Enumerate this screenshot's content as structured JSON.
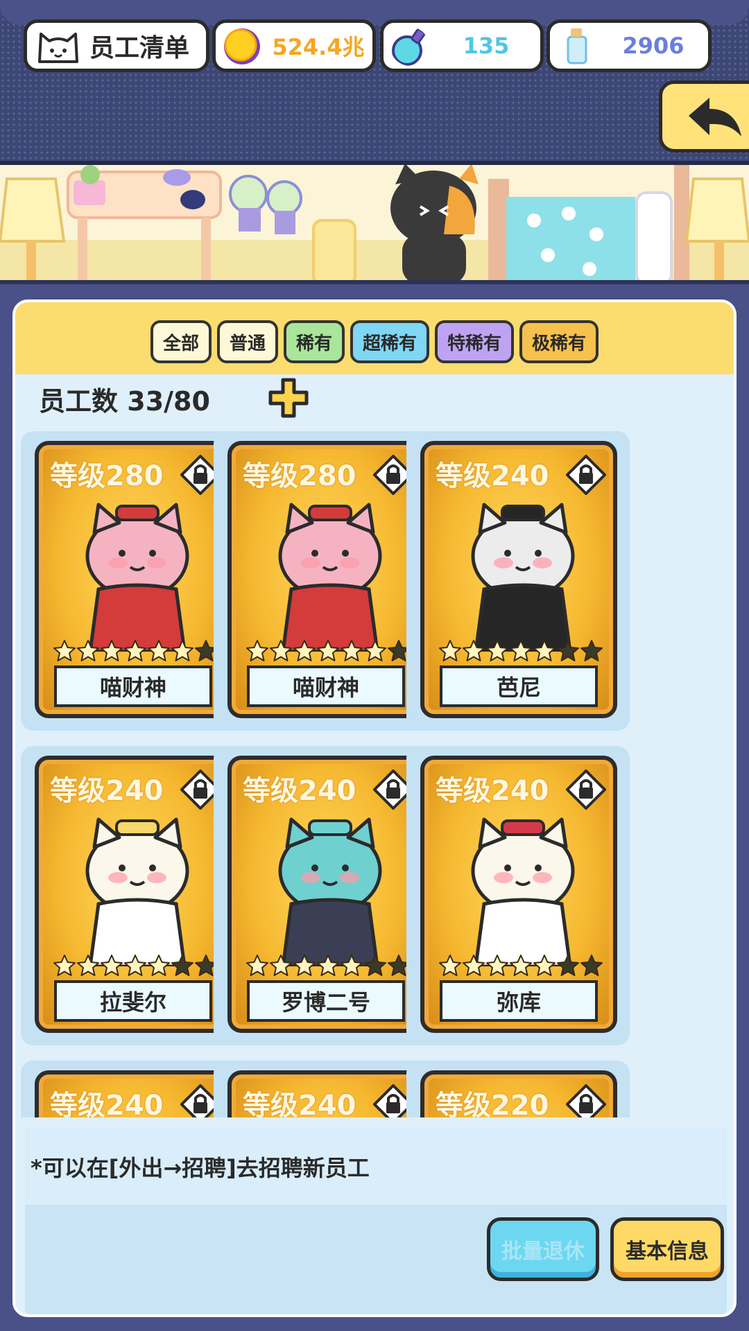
{
  "header": {
    "title": "员工清单",
    "coins": "524.4兆",
    "potion": "135",
    "bottle": "2906"
  },
  "tabs": [
    {
      "label": "全部",
      "color": "#fff8d6"
    },
    {
      "label": "普通",
      "color": "#fff8d6"
    },
    {
      "label": "稀有",
      "color": "#a9e59a"
    },
    {
      "label": "超稀有",
      "color": "#7fd7f3"
    },
    {
      "label": "特稀有",
      "color": "#bfa3f3"
    },
    {
      "label": "极稀有",
      "color": "#f7c14d"
    }
  ],
  "staff_count": {
    "label": "员工数",
    "value": "33/80"
  },
  "cards": [
    {
      "level": "等级280",
      "name": "喵财神",
      "stars": 7,
      "filled": 6,
      "cat": "fortune"
    },
    {
      "level": "等级280",
      "name": "喵财神",
      "stars": 7,
      "filled": 6,
      "cat": "fortune"
    },
    {
      "level": "等级240",
      "name": "芭尼",
      "stars": 7,
      "filled": 5,
      "cat": "bunny"
    },
    {
      "level": "等级240",
      "name": "拉斐尔",
      "stars": 7,
      "filled": 5,
      "cat": "angel"
    },
    {
      "level": "等级240",
      "name": "罗博二号",
      "stars": 7,
      "filled": 5,
      "cat": "robot"
    },
    {
      "level": "等级240",
      "name": "弥库",
      "stars": 7,
      "filled": 5,
      "cat": "miku"
    },
    {
      "level": "等级240",
      "name": "",
      "stars": 0,
      "filled": 0,
      "cat": "partial"
    },
    {
      "level": "等级240",
      "name": "",
      "stars": 0,
      "filled": 0,
      "cat": "partial"
    },
    {
      "level": "等级220",
      "name": "",
      "stars": 0,
      "filled": 0,
      "cat": "partial"
    }
  ],
  "footer": {
    "note": "*可以在[外出→招聘]去招聘新员工",
    "retire_label": "批量退休",
    "info_label": "基本信息"
  },
  "icons": {
    "cat_head": "cat-head-icon",
    "coin": "gold-coin-icon",
    "potion": "potion-flask-icon",
    "bottle": "bottle-icon",
    "back": "back-arrow-icon",
    "lock": "lock-icon",
    "plus": "plus-icon",
    "star": "star-icon"
  }
}
